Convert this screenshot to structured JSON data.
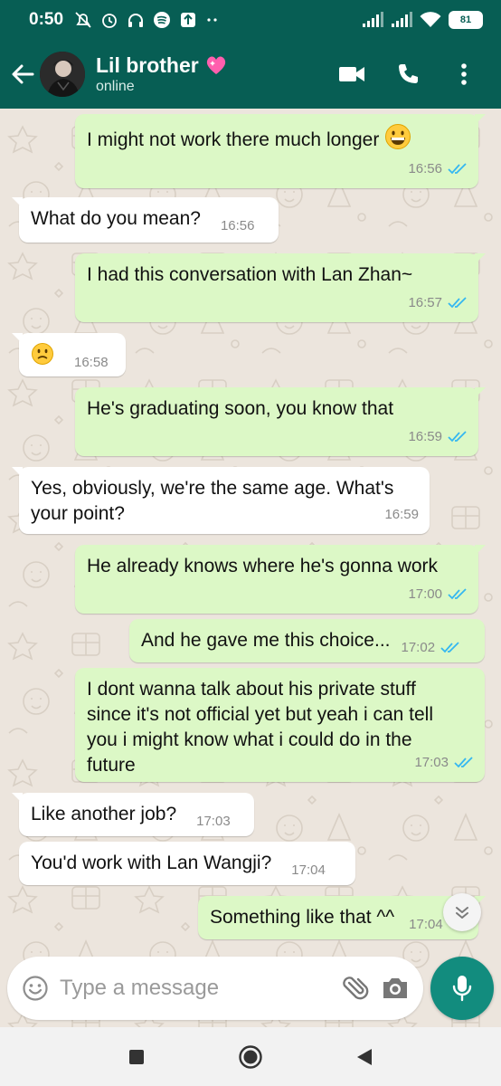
{
  "status_bar": {
    "time": "0:50",
    "battery": "81"
  },
  "header": {
    "contact_name": "Lil brother",
    "contact_status": "online",
    "name_emoji": "💓"
  },
  "messages": [
    {
      "dir": "out",
      "text": "I might not work there much longer",
      "emoji": "grinning-face",
      "time": "16:56",
      "ticks": "read"
    },
    {
      "dir": "in",
      "text": "What do you mean?",
      "time": "16:56"
    },
    {
      "dir": "out",
      "text": "I had this conversation with Lan Zhan~",
      "time": "16:57",
      "ticks": "read"
    },
    {
      "dir": "in",
      "text": "",
      "emoji": "confused-face",
      "time": "16:58"
    },
    {
      "dir": "out",
      "text": "He's graduating soon, you know that",
      "time": "16:59",
      "ticks": "read"
    },
    {
      "dir": "in",
      "text": "Yes, obviously, we're the same age. What's your point?",
      "time": "16:59"
    },
    {
      "dir": "out",
      "text": "He already knows where he's gonna work",
      "time": "17:00",
      "ticks": "read"
    },
    {
      "dir": "out",
      "text": "And he gave me this choice...",
      "time": "17:02",
      "ticks": "read"
    },
    {
      "dir": "out",
      "text": "I dont wanna talk about his private stuff since it's not official yet but yeah i can tell you i might know what i could do in the future",
      "time": "17:03",
      "ticks": "read"
    },
    {
      "dir": "in",
      "text": "Like another job?",
      "time": "17:03"
    },
    {
      "dir": "in",
      "text": "You'd work with Lan Wangji?",
      "time": "17:04"
    },
    {
      "dir": "out",
      "text": "Something like that ^^",
      "time": "17:04",
      "ticks": "read"
    }
  ],
  "composer": {
    "placeholder": "Type a message"
  },
  "colors": {
    "header": "#075e54",
    "outgoing": "#dcf8c6",
    "incoming": "#ffffff",
    "accent": "#128c7e",
    "read_ticks": "#34b7f1"
  },
  "icons": [
    "back-arrow-icon",
    "video-call-icon",
    "phone-icon",
    "more-options-icon",
    "emoji-icon",
    "attach-icon",
    "camera-icon",
    "mic-icon",
    "scroll-down-icon"
  ]
}
